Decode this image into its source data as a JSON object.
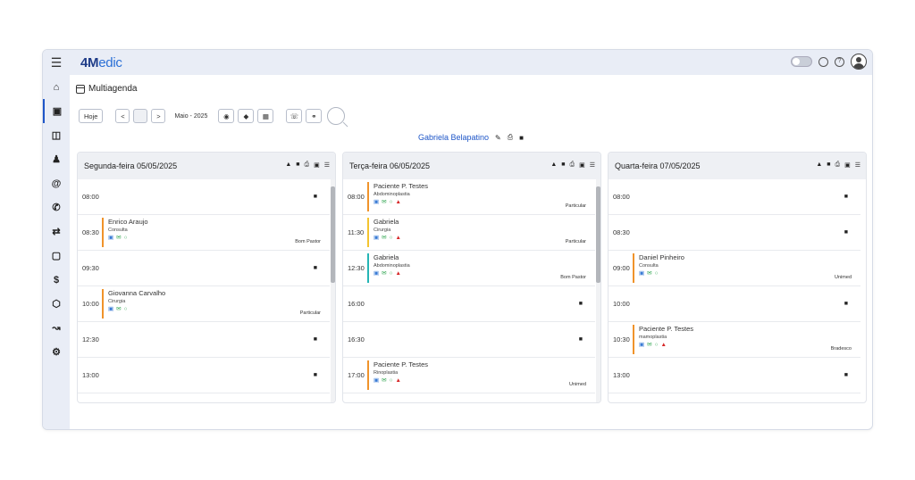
{
  "header": {
    "logo_prefix": "4M",
    "logo_suffix": "edic"
  },
  "sidebar": {
    "icons": [
      "home-icon",
      "calendar-icon",
      "car-icon",
      "person-icon",
      "at-icon",
      "phone-icon",
      "shuffle-icon",
      "clipboard-icon",
      "dollar-icon",
      "box-icon",
      "chart-icon",
      "gear-icon"
    ]
  },
  "page": {
    "title": "Multiagenda"
  },
  "toolbar": {
    "today_label": "Hoje",
    "prev_label": "<",
    "next_label": ">",
    "month_label": "Maio - 2025"
  },
  "doctor": {
    "name": "Gabriela Belapatino"
  },
  "days": [
    {
      "title": "Segunda-feira 05/05/2025",
      "slots": [
        {
          "time": "08:00",
          "locked": true
        },
        {
          "time": "08:30",
          "patient": "Enrico Araujo",
          "procedure": "Consulta",
          "plan": "Bom Pastor",
          "color": "orange",
          "warn": false
        },
        {
          "time": "09:30",
          "locked": true
        },
        {
          "time": "10:00",
          "patient": "Giovanna Carvalho",
          "procedure": "Cirurgia",
          "plan": "Particular",
          "color": "orange",
          "warn": false
        },
        {
          "time": "12:30",
          "locked": true
        },
        {
          "time": "13:00",
          "locked": true
        }
      ]
    },
    {
      "title": "Terça-feira 06/05/2025",
      "slots": [
        {
          "time": "08:00",
          "patient": "Paciente P. Testes",
          "procedure": "Abdominoplastia",
          "plan": "Particular",
          "color": "orange",
          "warn": true
        },
        {
          "time": "11:30",
          "patient": "Gabriela",
          "procedure": "Cirurgia",
          "plan": "Particular",
          "color": "yellow",
          "warn": true
        },
        {
          "time": "12:30",
          "patient": "Gabriela",
          "procedure": "Abdominoplastia",
          "plan": "Bom Pastor",
          "color": "teal",
          "warn": true
        },
        {
          "time": "16:00",
          "locked": true
        },
        {
          "time": "16:30",
          "locked": true
        },
        {
          "time": "17:00",
          "patient": "Paciente P. Testes",
          "procedure": "Rinoplastia",
          "plan": "Unimed",
          "color": "orange",
          "warn": true
        }
      ]
    },
    {
      "title": "Quarta-feira 07/05/2025",
      "slots": [
        {
          "time": "08:00",
          "locked": true
        },
        {
          "time": "08:30",
          "locked": true
        },
        {
          "time": "09:00",
          "patient": "Daniel Pinheiro",
          "procedure": "Consulta",
          "plan": "Unimed",
          "color": "orange",
          "warn": false
        },
        {
          "time": "10:00",
          "locked": true
        },
        {
          "time": "10:30",
          "patient": "Paciente P. Testes",
          "procedure": "mamoplastia",
          "plan": "Bradesco",
          "color": "orange",
          "warn": true
        },
        {
          "time": "13:00",
          "locked": true
        }
      ]
    }
  ]
}
